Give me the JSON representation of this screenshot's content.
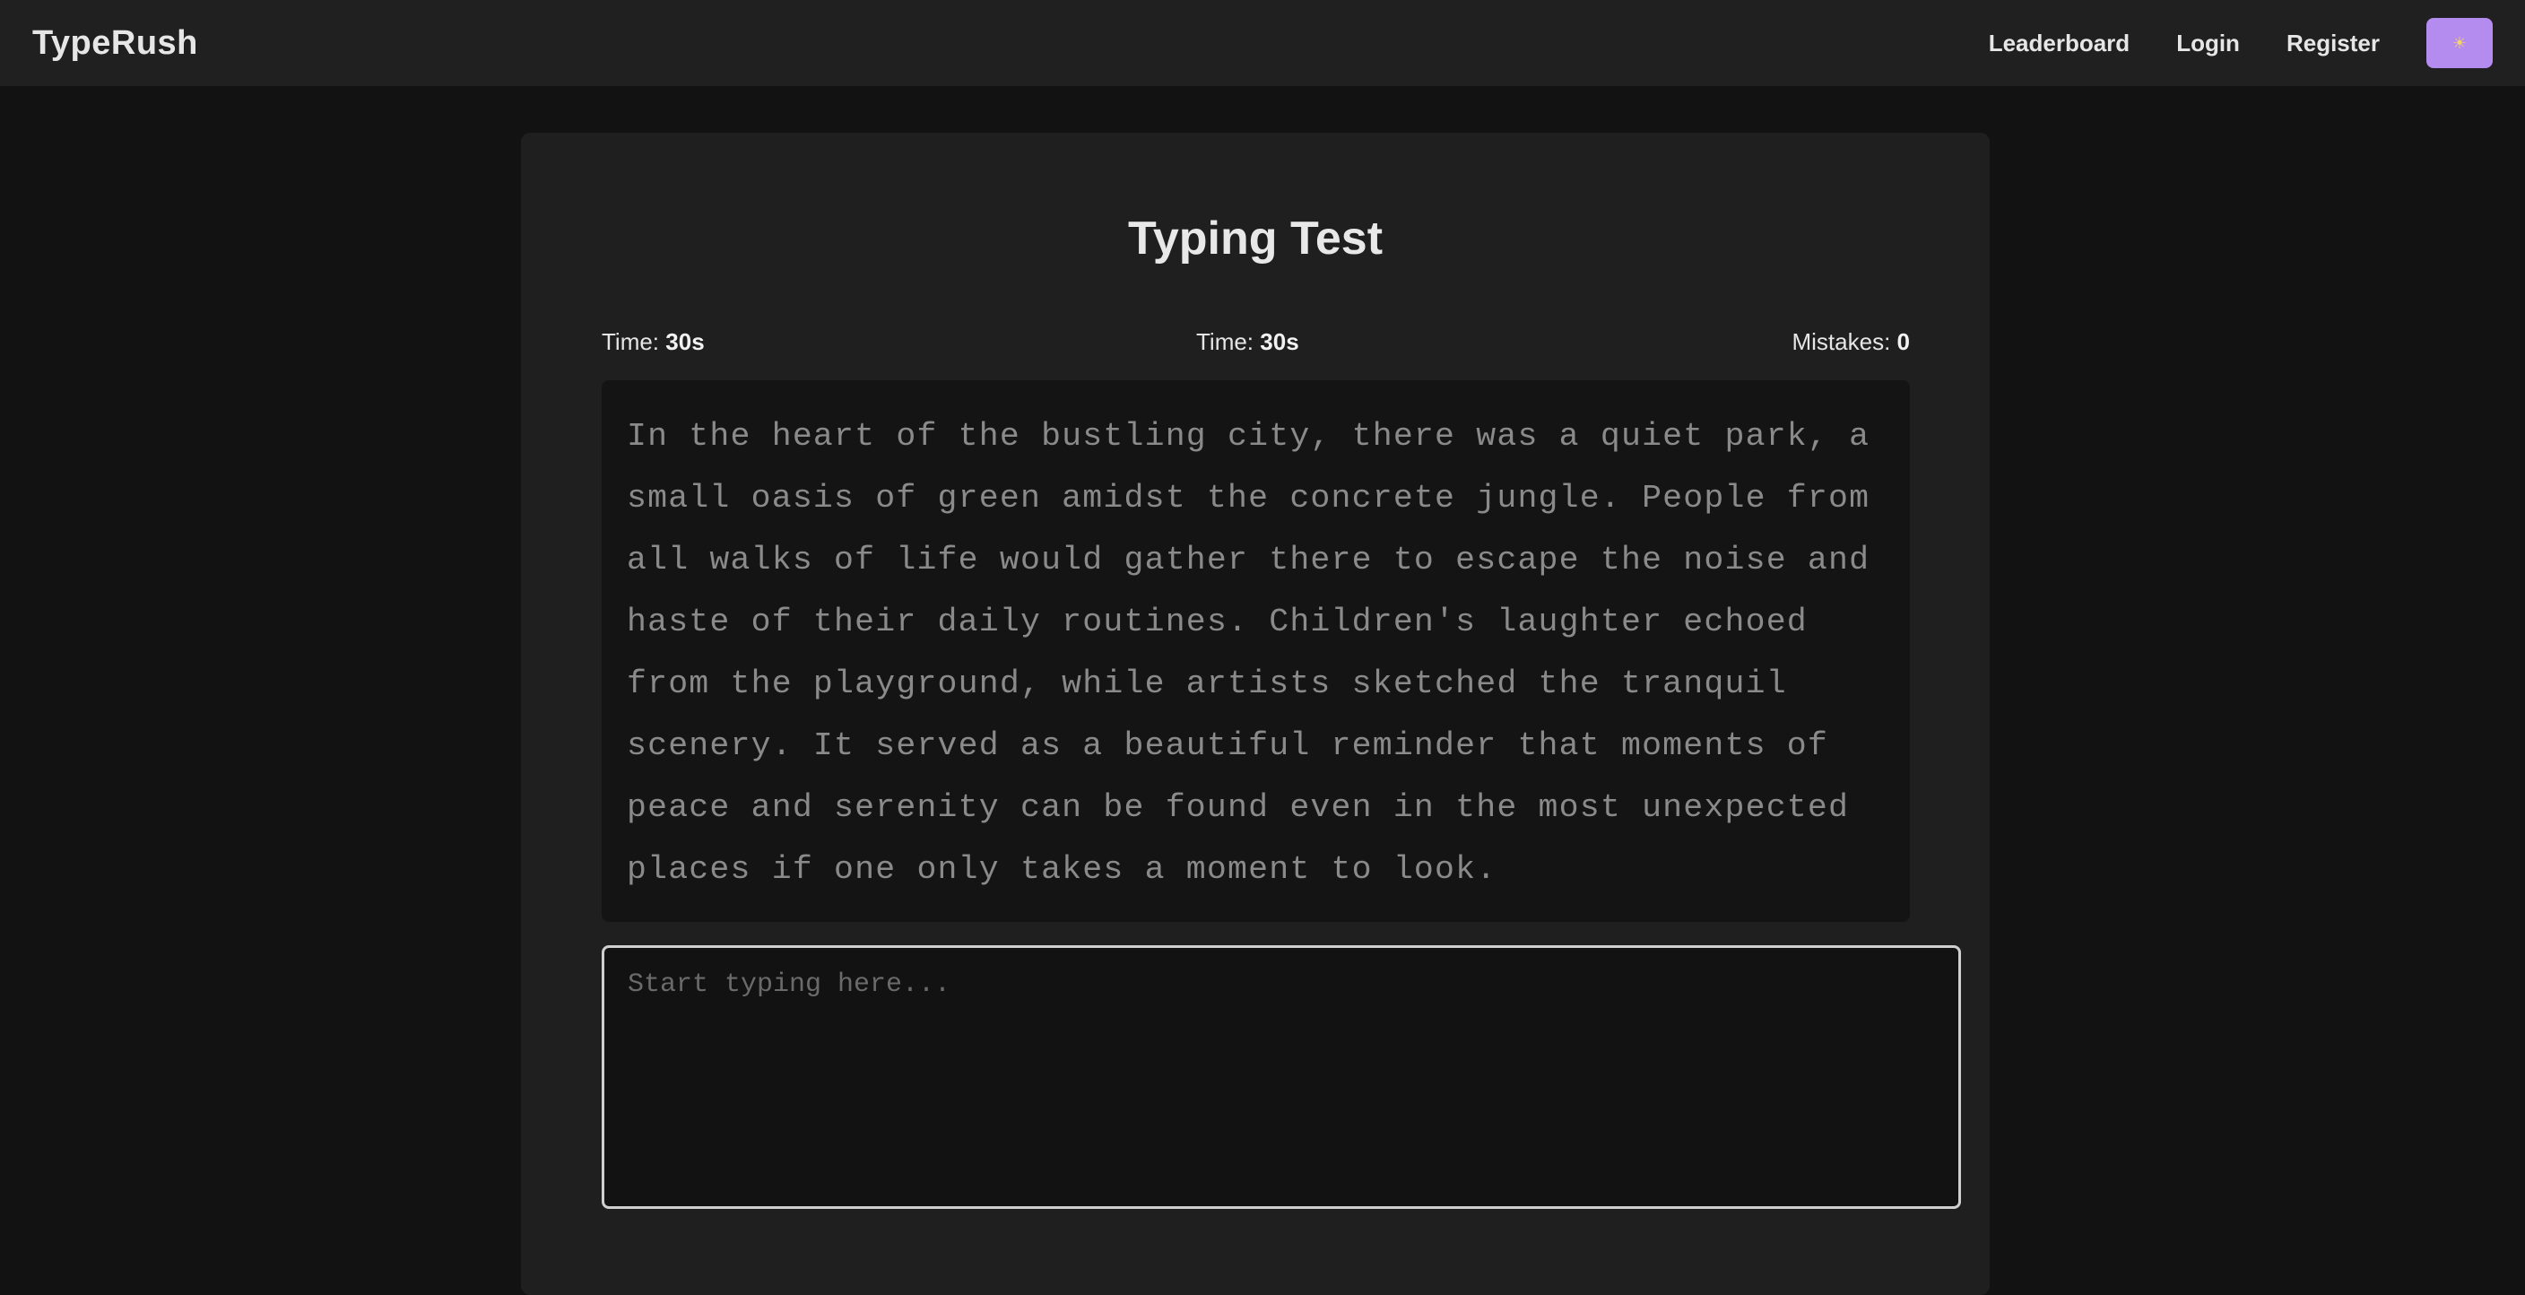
{
  "navbar": {
    "brand": "TypeRush",
    "links": [
      "Leaderboard",
      "Login",
      "Register"
    ],
    "theme_toggle_icon": "sun-icon",
    "theme_toggle_glyph": "☀",
    "accent_color": "#b48cf0"
  },
  "test": {
    "title": "Typing Test",
    "stats": [
      {
        "label": "Time:",
        "value": "30s"
      },
      {
        "label": "Time:",
        "value": "30s"
      },
      {
        "label": "Mistakes:",
        "value": "0"
      }
    ],
    "passage": "In the heart of the bustling city, there was a quiet park, a small oasis of green amidst the concrete jungle. People from all walks of life would gather there to escape the noise and haste of their daily routines. Children's laughter echoed from the playground, while artists sketched the tranquil scenery. It served as a beautiful reminder that moments of peace and serenity can be found even in the most unexpected places if one only takes a moment to look.",
    "input": {
      "value": "",
      "placeholder": "Start typing here..."
    }
  }
}
